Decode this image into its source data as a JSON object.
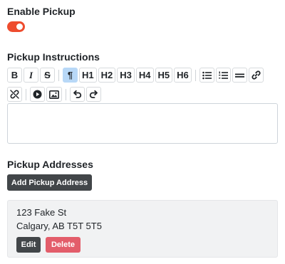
{
  "pickup": {
    "enable_label": "Enable Pickup",
    "enabled": true,
    "toggle_color": "#ee4c2e"
  },
  "instructions": {
    "label": "Pickup Instructions",
    "editor_value": "",
    "toolbar_row1": [
      {
        "name": "bold-button",
        "text": "B",
        "icon": "bold-icon"
      },
      {
        "name": "italic-button",
        "text": "I",
        "icon": "italic-icon"
      },
      {
        "name": "strikethrough-button",
        "text": "S",
        "icon": "strikethrough-icon"
      },
      {
        "name": "paragraph-button",
        "text": "¶",
        "icon": "paragraph-icon",
        "active": true
      },
      {
        "name": "h1-button",
        "text": "H1"
      },
      {
        "name": "h2-button",
        "text": "H2"
      },
      {
        "name": "h3-button",
        "text": "H3"
      },
      {
        "name": "h4-button",
        "text": "H4"
      },
      {
        "name": "h5-button",
        "text": "H5"
      },
      {
        "name": "h6-button",
        "text": "H6"
      },
      {
        "name": "bullet-list-button",
        "icon": "bullet-list-icon"
      },
      {
        "name": "ordered-list-button",
        "icon": "ordered-list-icon"
      },
      {
        "name": "horizontal-rule-button",
        "icon": "horizontal-rule-icon"
      },
      {
        "name": "link-button",
        "icon": "link-icon"
      }
    ],
    "toolbar_row2": [
      {
        "name": "unlink-button",
        "icon": "unlink-icon"
      },
      {
        "name": "video-button",
        "icon": "play-icon"
      },
      {
        "name": "image-button",
        "icon": "image-icon"
      },
      {
        "name": "undo-button",
        "icon": "undo-icon"
      },
      {
        "name": "redo-button",
        "icon": "redo-icon"
      }
    ],
    "active_color": "#b8d8f7"
  },
  "addresses": {
    "label": "Pickup Addresses",
    "add_button": "Add Pickup Address",
    "items": [
      {
        "line1": "123 Fake St",
        "line2": "Calgary, AB T5T 5T5",
        "edit_label": "Edit",
        "delete_label": "Delete"
      }
    ]
  }
}
